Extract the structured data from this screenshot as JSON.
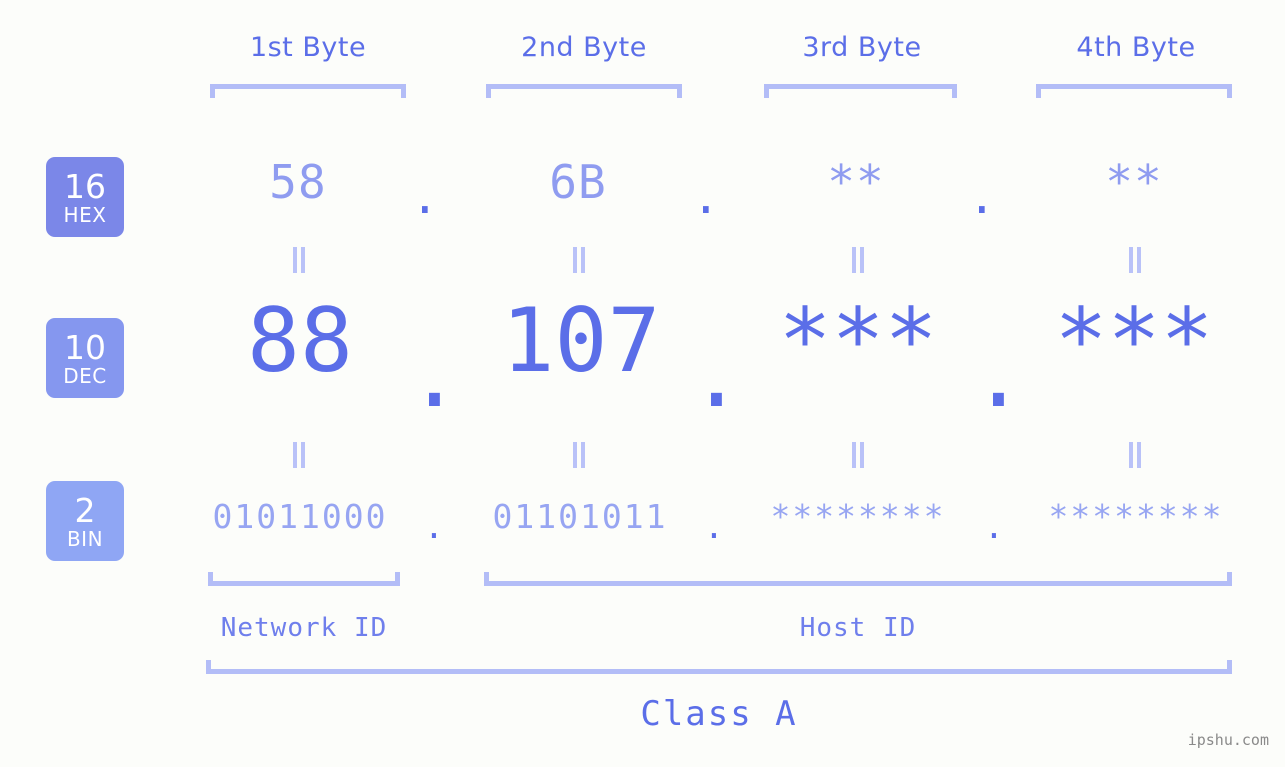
{
  "watermark": "ipshu.com",
  "byte_headers": [
    {
      "label": "1st Byte"
    },
    {
      "label": "2nd Byte"
    },
    {
      "label": "3rd Byte"
    },
    {
      "label": "4th Byte"
    }
  ],
  "bases": [
    {
      "number": "16",
      "name": "HEX",
      "color": "#7b87e8"
    },
    {
      "number": "10",
      "name": "DEC",
      "color": "#8597ef"
    },
    {
      "number": "2",
      "name": "BIN",
      "color": "#8fa6f4"
    }
  ],
  "rows": {
    "hex": {
      "values": [
        "58",
        "6B",
        "**",
        "**"
      ],
      "separators": [
        ".",
        ".",
        "."
      ]
    },
    "dec": {
      "values": [
        "88",
        "107",
        "***",
        "***"
      ],
      "separators": [
        ".",
        ".",
        "."
      ]
    },
    "bin": {
      "values": [
        "01011000",
        "01101011",
        "********",
        "********"
      ],
      "separators": [
        ".",
        ".",
        "."
      ]
    }
  },
  "segments": {
    "network_id": "Network ID",
    "host_id": "Host ID",
    "class": "Class A"
  },
  "colors": {
    "background": "#fcfdfa",
    "accent": "#5b6ee8",
    "accent_light": "#b3bdf7",
    "badge_hex": "#7b87e8",
    "badge_dec": "#8597ef",
    "badge_bin": "#8fa6f4"
  }
}
